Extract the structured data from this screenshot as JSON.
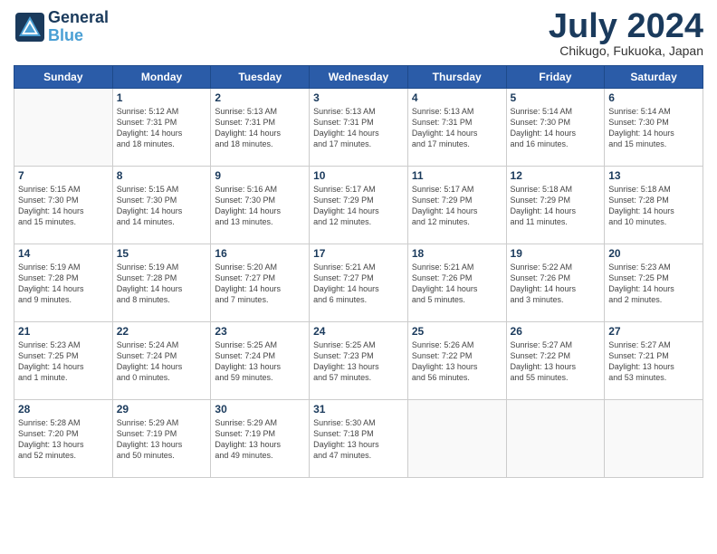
{
  "header": {
    "logo_line1": "General",
    "logo_line2": "Blue",
    "month": "July 2024",
    "location": "Chikugo, Fukuoka, Japan"
  },
  "weekdays": [
    "Sunday",
    "Monday",
    "Tuesday",
    "Wednesday",
    "Thursday",
    "Friday",
    "Saturday"
  ],
  "weeks": [
    [
      {
        "day": "",
        "text": ""
      },
      {
        "day": "1",
        "text": "Sunrise: 5:12 AM\nSunset: 7:31 PM\nDaylight: 14 hours\nand 18 minutes."
      },
      {
        "day": "2",
        "text": "Sunrise: 5:13 AM\nSunset: 7:31 PM\nDaylight: 14 hours\nand 18 minutes."
      },
      {
        "day": "3",
        "text": "Sunrise: 5:13 AM\nSunset: 7:31 PM\nDaylight: 14 hours\nand 17 minutes."
      },
      {
        "day": "4",
        "text": "Sunrise: 5:13 AM\nSunset: 7:31 PM\nDaylight: 14 hours\nand 17 minutes."
      },
      {
        "day": "5",
        "text": "Sunrise: 5:14 AM\nSunset: 7:30 PM\nDaylight: 14 hours\nand 16 minutes."
      },
      {
        "day": "6",
        "text": "Sunrise: 5:14 AM\nSunset: 7:30 PM\nDaylight: 14 hours\nand 15 minutes."
      }
    ],
    [
      {
        "day": "7",
        "text": "Sunrise: 5:15 AM\nSunset: 7:30 PM\nDaylight: 14 hours\nand 15 minutes."
      },
      {
        "day": "8",
        "text": "Sunrise: 5:15 AM\nSunset: 7:30 PM\nDaylight: 14 hours\nand 14 minutes."
      },
      {
        "day": "9",
        "text": "Sunrise: 5:16 AM\nSunset: 7:30 PM\nDaylight: 14 hours\nand 13 minutes."
      },
      {
        "day": "10",
        "text": "Sunrise: 5:17 AM\nSunset: 7:29 PM\nDaylight: 14 hours\nand 12 minutes."
      },
      {
        "day": "11",
        "text": "Sunrise: 5:17 AM\nSunset: 7:29 PM\nDaylight: 14 hours\nand 12 minutes."
      },
      {
        "day": "12",
        "text": "Sunrise: 5:18 AM\nSunset: 7:29 PM\nDaylight: 14 hours\nand 11 minutes."
      },
      {
        "day": "13",
        "text": "Sunrise: 5:18 AM\nSunset: 7:28 PM\nDaylight: 14 hours\nand 10 minutes."
      }
    ],
    [
      {
        "day": "14",
        "text": "Sunrise: 5:19 AM\nSunset: 7:28 PM\nDaylight: 14 hours\nand 9 minutes."
      },
      {
        "day": "15",
        "text": "Sunrise: 5:19 AM\nSunset: 7:28 PM\nDaylight: 14 hours\nand 8 minutes."
      },
      {
        "day": "16",
        "text": "Sunrise: 5:20 AM\nSunset: 7:27 PM\nDaylight: 14 hours\nand 7 minutes."
      },
      {
        "day": "17",
        "text": "Sunrise: 5:21 AM\nSunset: 7:27 PM\nDaylight: 14 hours\nand 6 minutes."
      },
      {
        "day": "18",
        "text": "Sunrise: 5:21 AM\nSunset: 7:26 PM\nDaylight: 14 hours\nand 5 minutes."
      },
      {
        "day": "19",
        "text": "Sunrise: 5:22 AM\nSunset: 7:26 PM\nDaylight: 14 hours\nand 3 minutes."
      },
      {
        "day": "20",
        "text": "Sunrise: 5:23 AM\nSunset: 7:25 PM\nDaylight: 14 hours\nand 2 minutes."
      }
    ],
    [
      {
        "day": "21",
        "text": "Sunrise: 5:23 AM\nSunset: 7:25 PM\nDaylight: 14 hours\nand 1 minute."
      },
      {
        "day": "22",
        "text": "Sunrise: 5:24 AM\nSunset: 7:24 PM\nDaylight: 14 hours\nand 0 minutes."
      },
      {
        "day": "23",
        "text": "Sunrise: 5:25 AM\nSunset: 7:24 PM\nDaylight: 13 hours\nand 59 minutes."
      },
      {
        "day": "24",
        "text": "Sunrise: 5:25 AM\nSunset: 7:23 PM\nDaylight: 13 hours\nand 57 minutes."
      },
      {
        "day": "25",
        "text": "Sunrise: 5:26 AM\nSunset: 7:22 PM\nDaylight: 13 hours\nand 56 minutes."
      },
      {
        "day": "26",
        "text": "Sunrise: 5:27 AM\nSunset: 7:22 PM\nDaylight: 13 hours\nand 55 minutes."
      },
      {
        "day": "27",
        "text": "Sunrise: 5:27 AM\nSunset: 7:21 PM\nDaylight: 13 hours\nand 53 minutes."
      }
    ],
    [
      {
        "day": "28",
        "text": "Sunrise: 5:28 AM\nSunset: 7:20 PM\nDaylight: 13 hours\nand 52 minutes."
      },
      {
        "day": "29",
        "text": "Sunrise: 5:29 AM\nSunset: 7:19 PM\nDaylight: 13 hours\nand 50 minutes."
      },
      {
        "day": "30",
        "text": "Sunrise: 5:29 AM\nSunset: 7:19 PM\nDaylight: 13 hours\nand 49 minutes."
      },
      {
        "day": "31",
        "text": "Sunrise: 5:30 AM\nSunset: 7:18 PM\nDaylight: 13 hours\nand 47 minutes."
      },
      {
        "day": "",
        "text": ""
      },
      {
        "day": "",
        "text": ""
      },
      {
        "day": "",
        "text": ""
      }
    ]
  ]
}
